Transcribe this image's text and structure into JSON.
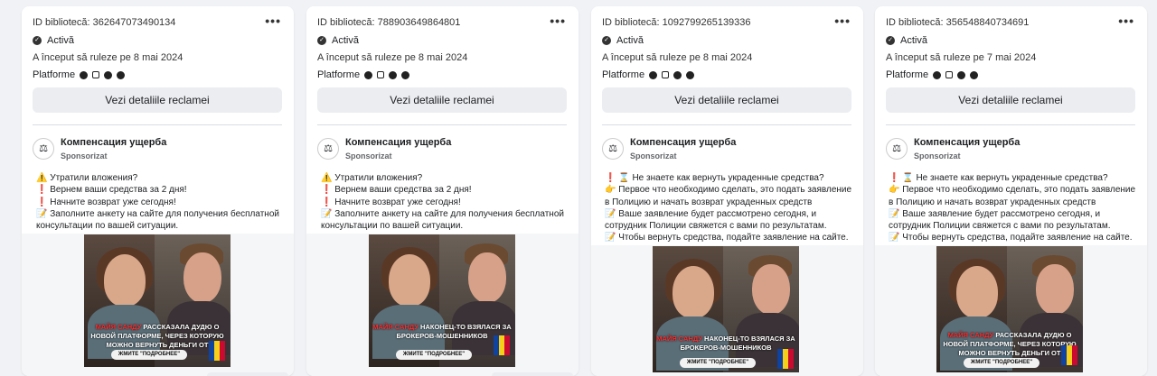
{
  "cards": [
    {
      "library_id": "ID bibliotecă: 362647073490134",
      "status": "Activă",
      "started": "A început să ruleze pe 8 mai 2024",
      "platforms_label": "Platforme",
      "details_button": "Vezi detaliile reclamei",
      "advertiser": "Компенсация ущерба",
      "sponsored": "Sponsorizat",
      "body": "⚠️ Утратили вложения?\n❗ Вернем ваши средства за 2 дня!\n❗ Начните возврат уже сегодня!\n📝 Заполните анкету на сайте для получения бесплатной консультации по вашей ситуации.",
      "caption_a": "МАЙЯ САНДУ",
      "caption_b": " РАССКАЗАЛА ДУДЮ О НОВОЙ ПЛАТФОРМЕ, ЧЕРЕЗ КОТОРУЮ МОЖНО ВЕРНУТЬ ДЕНЬГИ ОТ БРОКЕРОВ",
      "cta": "ЖМИТЕ \"ПОДРОБНЕЕ\""
    },
    {
      "library_id": "ID bibliotecă: 788903649864801",
      "status": "Activă",
      "started": "A început să ruleze pe 8 mai 2024",
      "platforms_label": "Platforme",
      "details_button": "Vezi detaliile reclamei",
      "advertiser": "Компенсация ущерба",
      "sponsored": "Sponsorizat",
      "body": "⚠️ Утратили вложения?\n❗ Вернем ваши средства за 2 дня!\n❗ Начните возврат уже сегодня!\n📝 Заполните анкету на сайте для получения бесплатной консультации по вашей ситуации.",
      "caption_a": "МАЙЯ САНДУ",
      "caption_b": " НАКОНЕЦ-ТО ВЗЯЛАСЯ ЗА БРОКЕРОВ-МОШЕННИКОВ",
      "cta": "ЖМИТЕ \"ПОДРОБНЕЕ\""
    },
    {
      "library_id": "ID bibliotecă: 1092799265139336",
      "status": "Activă",
      "started": "A început să ruleze pe 8 mai 2024",
      "platforms_label": "Platforme",
      "details_button": "Vezi detaliile reclamei",
      "advertiser": "Компенсация ущерба",
      "sponsored": "Sponsorizat",
      "body": "❗ ⌛ Не знаете как вернуть украденные средства?\n👉 Первое что необходимо сделать, это подать заявление в Полицию и начать возврат украденных средств\n📝 Ваше заявление будет рассмотрено сегодня, и сотрудник Полиции свяжется с вами по результатам.\n📝 Чтобы вернуть средства, подайте заявление на сайте.",
      "caption_a": "МАЙЯ САНДУ",
      "caption_b": " НАКОНЕЦ-ТО ВЗЯЛАСЯ ЗА БРОКЕРОВ-МОШЕННИКОВ",
      "cta": "ЖМИТЕ \"ПОДРОБНЕЕ\""
    },
    {
      "library_id": "ID bibliotecă: 356548840734691",
      "status": "Activă",
      "started": "A început să ruleze pe 7 mai 2024",
      "platforms_label": "Platforme",
      "details_button": "Vezi detaliile reclamei",
      "advertiser": "Компенсация ущерба",
      "sponsored": "Sponsorizat",
      "body": "❗ ⌛ Не знаете как вернуть украденные средства?\n👉 Первое что необходимо сделать, это подать заявление в Полицию и начать возврат украденных средств\n📝 Ваше заявление будет рассмотрено сегодня, и сотрудник Полиции свяжется с вами по результатам.\n📝 Чтобы вернуть средства, подайте заявление на сайте.",
      "caption_a": "МАЙЯ САНДУ",
      "caption_b": " РАССКАЗАЛА ДУДЮ О НОВОЙ ПЛАТФОРМЕ, ЧЕРЕЗ КОТОРУЮ МОЖНО ВЕРНУТЬ ДЕНЬГИ ОТ БРОКЕРОВ",
      "cta": "ЖМИТЕ \"ПОДРОБНЕЕ\""
    }
  ],
  "icons": {
    "more": "more-options-icon",
    "check": "check-circle-icon",
    "platforms": [
      "facebook-icon",
      "instagram-icon",
      "audience-network-icon",
      "messenger-icon"
    ]
  }
}
